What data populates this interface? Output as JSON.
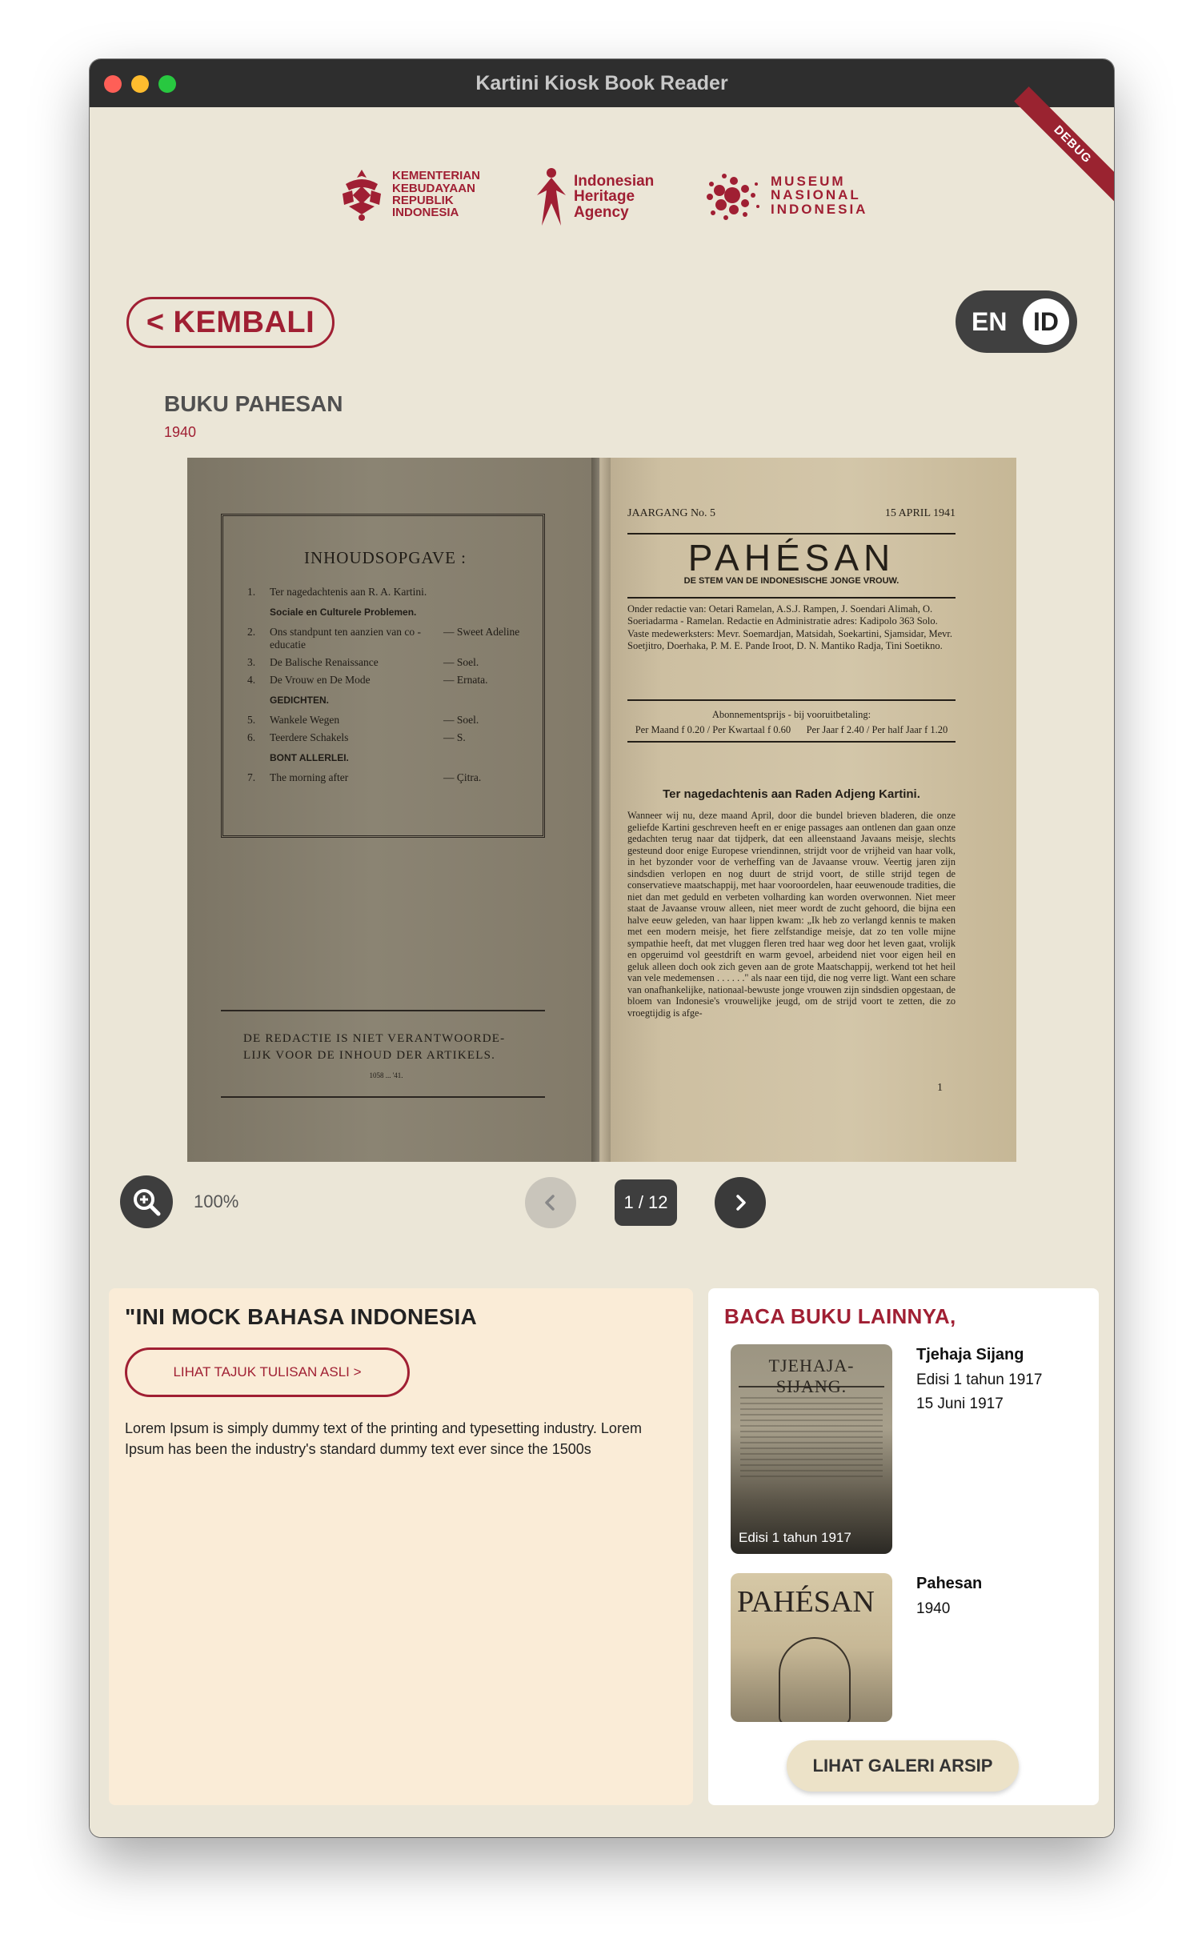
{
  "window": {
    "title": "Kartini Kiosk Book Reader",
    "debug_banner": "DEBUG"
  },
  "logos": {
    "kementerian": "KEMENTERIAN KEBUDAYAAN REPUBLIK INDONESIA",
    "kementerian_lines": [
      "KEMENTERIAN",
      "KEBUDAYAAN",
      "REPUBLIK",
      "INDONESIA"
    ],
    "heritage_lines": [
      "Indonesian",
      "Heritage",
      "Agency"
    ],
    "museum_lines": [
      "MUSEUM",
      "NASIONAL",
      "INDONESIA"
    ]
  },
  "header": {
    "back_label": "< KEMBALI",
    "lang_en": "EN",
    "lang_id": "ID",
    "selected_lang": "ID"
  },
  "book": {
    "title": "BUKU PAHESAN",
    "year": "1940"
  },
  "scan": {
    "left_page": {
      "toc_title": "INHOUDSOPGAVE :",
      "rows": [
        {
          "num": "1.",
          "text": "Ter nagedachtenis aan R. A. Kartini.",
          "author": ""
        },
        {
          "section": "Sociale en Culturele Problemen."
        },
        {
          "num": "2.",
          "text": "Ons standpunt ten aanzien van co - educatie",
          "author": "— Sweet Adeline"
        },
        {
          "num": "3.",
          "text": "De Balische Renaissance",
          "author": "— Soel."
        },
        {
          "num": "4.",
          "text": "De Vrouw en De Mode",
          "author": "— Ernata."
        },
        {
          "section": "GEDICHTEN."
        },
        {
          "num": "5.",
          "text": "Wankele Wegen",
          "author": "— Soel."
        },
        {
          "num": "6.",
          "text": "Teerdere Schakels",
          "author": "— S."
        },
        {
          "section": "BONT ALLERLEI."
        },
        {
          "num": "7.",
          "text": "The morning after",
          "author": "— Çitra."
        }
      ],
      "note": "DE REDACTIE IS NIET VERANTWOORDE- LIJK VOOR DE INHOUD DER ARTIKELS.",
      "note_foot": "1058 ... '41."
    },
    "right_page": {
      "issue_left": "JAARGANG No. 5",
      "issue_right": "15 APRIL 1941",
      "masthead": "PAHÉSAN",
      "subtitle": "DE STEM VAN DE INDONESISCHE JONGE VROUW.",
      "info": "Onder redactie van: Oetari Ramelan, A.S.J. Rampen, J. Soendari Alimah, O. Soeriadarma - Ramelan. Redactie en Administratie adres: Kadipolo 363 Solo. Vaste medewerksters: Mevr. Soemardjan, Matsidah, Soekartini, Sjamsidar, Mevr. Soetjitro, Doerhaka, P. M. E. Pande Iroot, D. N. Mantiko Radja, Tini Soetikno.",
      "abon_title": "Abonnementsprijs - bij vooruitbetaling:",
      "abon_left": "Per Maand f 0.20 / Per Kwartaal f 0.60",
      "abon_right": "Per Jaar f 2.40 / Per half Jaar f 1.20",
      "article_title": "Ter nagedachtenis aan Raden Adjeng Kartini.",
      "article_body": "Wanneer wij nu, deze maand April, door die bundel brieven bladeren, die onze geliefde Kartini geschreven heeft en er enige passages aan ontlenen dan gaan onze gedachten terug naar dat tijdperk, dat een alleenstaand Javaans meisje, slechts gesteund door enige Europese vriendinnen, strijdt voor de vrijheid van haar volk, in het byzonder voor de verheffing van de Javaanse vrouw. Veertig jaren zijn sindsdien verlopen en nog duurt de strijd voort, de stille strijd tegen de conservatieve maatschappij, met haar vooroordelen, haar eeuwenoude tradities, die niet dan met geduld en verbeten volharding kan worden overwonnen. Niet meer staat de Javaanse vrouw alleen, niet meer wordt de zucht gehoord, die bijna een halve eeuw geleden, van haar lippen kwam: „Ik heb zo verlangd kennis te maken met een modern meisje, het fiere zelfstandige meisje, dat zo ten volle mijne sympathie heeft, dat met vluggen fleren tred haar weg door het leven gaat, vrolijk en opgeruimd vol geestdrift en warm gevoel, arbeidend niet voor eigen heil en geluk alleen doch ook zich geven aan de grote Maatschappij, werkend tot het heil van vele medemensen . . . . . .\" als naar een tijd, die nog verre ligt. Want een schare van onafhankelijke, nationaal-bewuste jonge vrouwen zijn sindsdien opgestaan, de bloem van Indonesie's vrouwelijke jeugd, om de strijd voort te zetten, die zo vroegtijdig is afge-",
      "page_number": "1"
    }
  },
  "controls": {
    "zoom_label": "100%",
    "page_current": 1,
    "page_total": 12,
    "page_indicator": "1 / 12"
  },
  "description": {
    "title": "\"INI MOCK BAHASA INDONESIA",
    "original_button": "LIHAT TAJUK TULISAN ASLI >",
    "text": "Lorem Ipsum is simply dummy text of the printing and typesetting industry. Lorem Ipsum has been the industry's standard dummy text ever since the 1500s"
  },
  "related": {
    "title": "BACA BUKU LAINNYA,",
    "books": [
      {
        "name": "Tjehaja Sijang",
        "meta1": "Edisi 1 tahun 1917",
        "meta2": "15 Juni 1917",
        "thumb_caption": "Edisi 1 tahun 1917",
        "thumb_head": "TJEHAJA-SIJANG."
      },
      {
        "name": "Pahesan",
        "meta1": "1940",
        "meta2": "",
        "thumb_head": "PAHÉSAN"
      }
    ],
    "gallery_button": "LIHAT GALERI ARSIP"
  },
  "colors": {
    "accent": "#a01f33",
    "background": "#ebe6d7",
    "description_panel": "#faecd7",
    "dark_button": "#3e3e3e"
  },
  "icons": {
    "zoom": "zoom-in-icon",
    "prev": "chevron-left-icon",
    "next": "chevron-right-icon"
  }
}
